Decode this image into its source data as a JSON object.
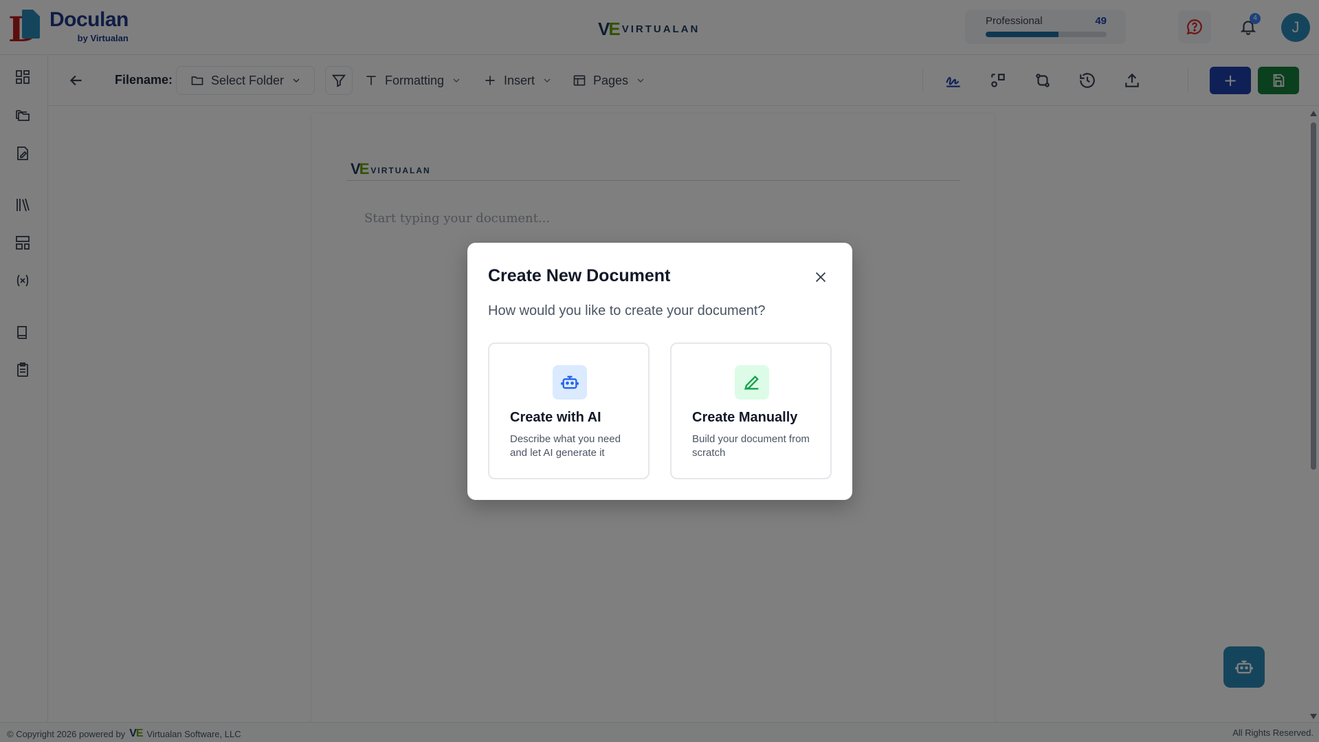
{
  "brand": {
    "name": "Doculan",
    "sub": "by Virtualan"
  },
  "center_logo": {
    "mark": "VE",
    "word": "VIRTUALAN"
  },
  "plan": {
    "name": "Professional",
    "count": "49",
    "progress_percent": 60
  },
  "notifications": {
    "badge": "4"
  },
  "user": {
    "initial": "J"
  },
  "sidebar": {
    "items": [
      {
        "name": "dashboard-icon"
      },
      {
        "name": "folders-icon"
      },
      {
        "name": "document-edit-icon"
      },
      {
        "name": "library-icon"
      },
      {
        "name": "templates-icon"
      },
      {
        "name": "variables-icon"
      },
      {
        "name": "book-icon"
      },
      {
        "name": "clipboard-icon"
      }
    ]
  },
  "toolbar": {
    "filename_label": "Filename:",
    "folder_label": "Select Folder",
    "formatting_label": "Formatting",
    "insert_label": "Insert",
    "pages_label": "Pages",
    "plus_label": "+"
  },
  "document": {
    "header_mark": "VE",
    "header_word": "VIRTUALAN",
    "placeholder": "Start typing your document..."
  },
  "modal": {
    "title": "Create New Document",
    "subtitle": "How would you like to create your document?",
    "options": [
      {
        "title": "Create with AI",
        "description": "Describe what you need and let AI generate it",
        "icon": "robot-icon"
      },
      {
        "title": "Create Manually",
        "description": "Build your document from scratch",
        "icon": "pencil-icon"
      }
    ]
  },
  "footer": {
    "left_prefix": "© Copyright 2026 powered by",
    "left_mark": "VE",
    "left_company": "Virtualan Software, LLC",
    "right": "All Rights Reserved."
  },
  "colors": {
    "brand_blue": "#1f3a8a",
    "accent_teal": "#2a8ab8",
    "primary_button": "#1e40af",
    "save_button": "#15803d",
    "overlay": "rgba(0,0,0,0.5)"
  }
}
